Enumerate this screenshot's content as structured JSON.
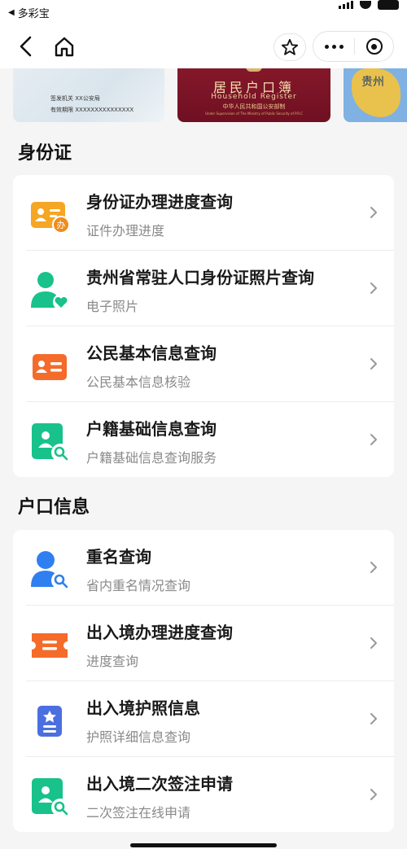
{
  "status_bar": {
    "back_app_label": "多彩宝"
  },
  "nav": {},
  "banner": {
    "id_card": {
      "line1": "签发机关  XX公安局",
      "line2": "有效期限  XXXXXXXXXXXXXXX"
    },
    "household": {
      "title": "居民户口簿",
      "subtitle": "Household  Register",
      "issuer": "中华人民共和国公安部制",
      "issuer_en": "Under Supervision of The Ministry of Public Security of P.R.C"
    },
    "map_card": {
      "text": "贵州"
    }
  },
  "sections": [
    {
      "title": "身份证",
      "items": [
        {
          "title": "身份证办理进度查询",
          "subtitle": "证件办理进度",
          "icon": "id-card-progress-icon"
        },
        {
          "title": "贵州省常驻人口身份证照片查询",
          "subtitle": "电子照片",
          "icon": "user-heart-icon"
        },
        {
          "title": "公民基本信息查询",
          "subtitle": "公民基本信息核验",
          "icon": "id-card-icon"
        },
        {
          "title": "户籍基础信息查询",
          "subtitle": "户籍基础信息查询服务",
          "icon": "profile-search-icon"
        }
      ]
    },
    {
      "title": "户口信息",
      "items": [
        {
          "title": "重名查询",
          "subtitle": "省内重名情况查询",
          "icon": "user-search-icon"
        },
        {
          "title": "出入境办理进度查询",
          "subtitle": "进度查询",
          "icon": "ticket-icon"
        },
        {
          "title": "出入境护照信息",
          "subtitle": "护照详细信息查询",
          "icon": "passport-icon"
        },
        {
          "title": "出入境二次签注申请",
          "subtitle": "二次签注在线申请",
          "icon": "profile-search-icon"
        }
      ]
    }
  ],
  "colors": {
    "orange": "#f5a623",
    "red_orange": "#f56b2a",
    "green": "#18c28a",
    "blue": "#2f7ff0",
    "indigo": "#4b6fe0"
  }
}
